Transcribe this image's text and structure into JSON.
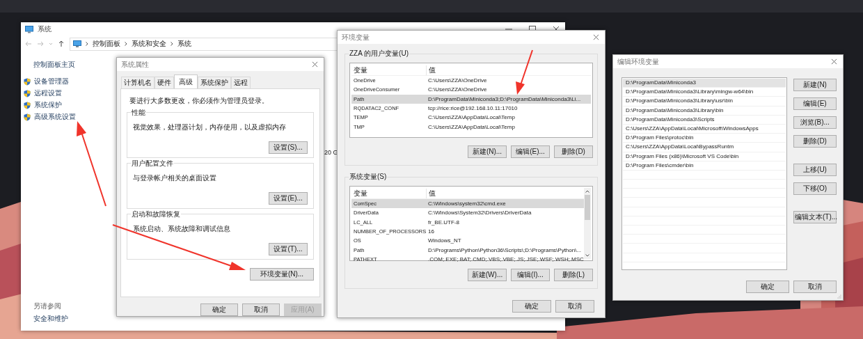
{
  "system_window": {
    "title": "系统",
    "breadcrumb": [
      "控制面板",
      "系统和安全",
      "系统"
    ],
    "sidebar_home": "控制面板主页",
    "sidebar_links": [
      "设备管理器",
      "远程设置",
      "系统保护",
      "高级系统设置"
    ],
    "partial_text": "20 G",
    "see_also": {
      "heading": "另请参阅",
      "links": [
        "安全和维护"
      ]
    }
  },
  "system_properties": {
    "title": "系统属性",
    "tabs": [
      {
        "label": "计算机名",
        "selected": false
      },
      {
        "label": "硬件",
        "selected": false
      },
      {
        "label": "高级",
        "selected": true
      },
      {
        "label": "系统保护",
        "selected": false
      },
      {
        "label": "远程",
        "selected": false
      }
    ],
    "admin_note": "要进行大多数更改，你必须作为管理员登录。",
    "groups": [
      {
        "title": "性能",
        "description": "视觉效果，处理器计划，内存使用，以及虚拟内存",
        "button": "设置(S)..."
      },
      {
        "title": "用户配置文件",
        "description": "与登录帐户相关的桌面设置",
        "button": "设置(E)..."
      },
      {
        "title": "启动和故障恢复",
        "description": "系统启动、系统故障和调试信息",
        "button": "设置(T)..."
      }
    ],
    "env_button": "环境变量(N)...",
    "buttons": [
      {
        "label": "确定",
        "disabled": false
      },
      {
        "label": "取消",
        "disabled": false
      },
      {
        "label": "应用(A)",
        "disabled": true
      }
    ]
  },
  "environment_variables": {
    "title": "环境变量",
    "groups": [
      {
        "title": "ZZA 的用户变量(U)",
        "columns": [
          "变量",
          "值"
        ],
        "rows": [
          {
            "name": "OneDrive",
            "value": "C:\\Users\\ZZA\\OneDrive",
            "selected": false
          },
          {
            "name": "OneDriveConsumer",
            "value": "C:\\Users\\ZZA\\OneDrive",
            "selected": false
          },
          {
            "name": "Path",
            "value": "D:\\ProgramData\\Miniconda3;D:\\ProgramData\\Miniconda3\\Li...",
            "selected": true
          },
          {
            "name": "RQDATAC2_CONF",
            "value": "tcp://rice:rice@192.168.10.11:17010",
            "selected": false
          },
          {
            "name": "TEMP",
            "value": "C:\\Users\\ZZA\\AppData\\Local\\Temp",
            "selected": false
          },
          {
            "name": "TMP",
            "value": "C:\\Users\\ZZA\\AppData\\Local\\Temp",
            "selected": false
          }
        ],
        "scrollbar": false,
        "buttons": [
          "新建(N)...",
          "编辑(E)...",
          "删除(D)"
        ]
      },
      {
        "title": "系统变量(S)",
        "columns": [
          "变量",
          "值"
        ],
        "rows": [
          {
            "name": "ComSpec",
            "value": "C:\\Windows\\system32\\cmd.exe",
            "selected": true
          },
          {
            "name": "DriverData",
            "value": "C:\\Windows\\System32\\Drivers\\DriverData",
            "selected": false
          },
          {
            "name": "LC_ALL",
            "value": "fr_BE.UTF-8",
            "selected": false
          },
          {
            "name": "NUMBER_OF_PROCESSORS",
            "value": "16",
            "selected": false
          },
          {
            "name": "OS",
            "value": "Windows_NT",
            "selected": false
          },
          {
            "name": "Path",
            "value": "D:\\Programs\\Python\\Python36\\Scripts\\;D:\\Programs\\Python\\...",
            "selected": false
          },
          {
            "name": "PATHEXT",
            "value": ".COM;.EXE;.BAT;.CMD;.VBS;.VBE;.JS;.JSE;.WSF;.WSH;.MSC",
            "selected": false
          }
        ],
        "scrollbar": true,
        "buttons": [
          "新建(W)...",
          "编辑(I)...",
          "删除(L)"
        ]
      }
    ],
    "buttons": [
      "确定",
      "取消"
    ]
  },
  "edit_environment_variable": {
    "title": "编辑环境变量",
    "entries": [
      {
        "text": "D:\\ProgramData\\Miniconda3",
        "selected": true
      },
      {
        "text": "D:\\ProgramData\\Miniconda3\\Library\\mingw-w64\\bin",
        "selected": false
      },
      {
        "text": "D:\\ProgramData\\Miniconda3\\Library\\usr\\bin",
        "selected": false
      },
      {
        "text": "D:\\ProgramData\\Miniconda3\\Library\\bin",
        "selected": false
      },
      {
        "text": "D:\\ProgramData\\Miniconda3\\Scripts",
        "selected": false
      },
      {
        "text": "C:\\Users\\ZZA\\AppData\\Local\\Microsoft\\WindowsApps",
        "selected": false
      },
      {
        "text": "D:\\Program Files\\protoc\\bin",
        "selected": false
      },
      {
        "text": "C:\\Users\\ZZA\\AppData\\Local\\BypassRuntm",
        "selected": false
      },
      {
        "text": "D:\\Program Files (x86)\\Microsoft VS Code\\bin",
        "selected": false
      },
      {
        "text": "D:\\Program Files\\cmder\\bin",
        "selected": false
      }
    ],
    "side_button_groups": [
      [
        "新建(N)",
        "编辑(E)",
        "浏览(B)...",
        "删除(D)"
      ],
      [
        "上移(U)",
        "下移(O)"
      ],
      [
        "编辑文本(T)..."
      ]
    ],
    "buttons": [
      "确定",
      "取消"
    ]
  }
}
